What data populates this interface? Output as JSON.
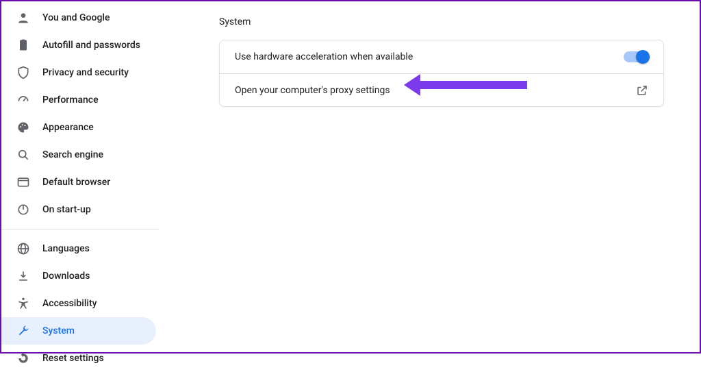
{
  "sidebar": {
    "group1": [
      {
        "label": "You and Google",
        "icon": "person-icon"
      },
      {
        "label": "Autofill and passwords",
        "icon": "clipboard-icon"
      },
      {
        "label": "Privacy and security",
        "icon": "shield-icon"
      },
      {
        "label": "Performance",
        "icon": "speed-icon"
      },
      {
        "label": "Appearance",
        "icon": "palette-icon"
      },
      {
        "label": "Search engine",
        "icon": "search-icon"
      },
      {
        "label": "Default browser",
        "icon": "browser-icon"
      },
      {
        "label": "On start-up",
        "icon": "power-icon"
      }
    ],
    "group2": [
      {
        "label": "Languages",
        "icon": "globe-icon"
      },
      {
        "label": "Downloads",
        "icon": "download-icon"
      },
      {
        "label": "Accessibility",
        "icon": "accessibility-icon"
      },
      {
        "label": "System",
        "icon": "wrench-icon",
        "selected": true
      },
      {
        "label": "Reset settings",
        "icon": "reset-icon"
      }
    ]
  },
  "main": {
    "title": "System",
    "rows": {
      "hw_accel": "Use hardware acceleration when available",
      "proxy": "Open your computer's proxy settings"
    }
  },
  "colors": {
    "accent": "#1a73e8",
    "arrow": "#7c3aed"
  }
}
